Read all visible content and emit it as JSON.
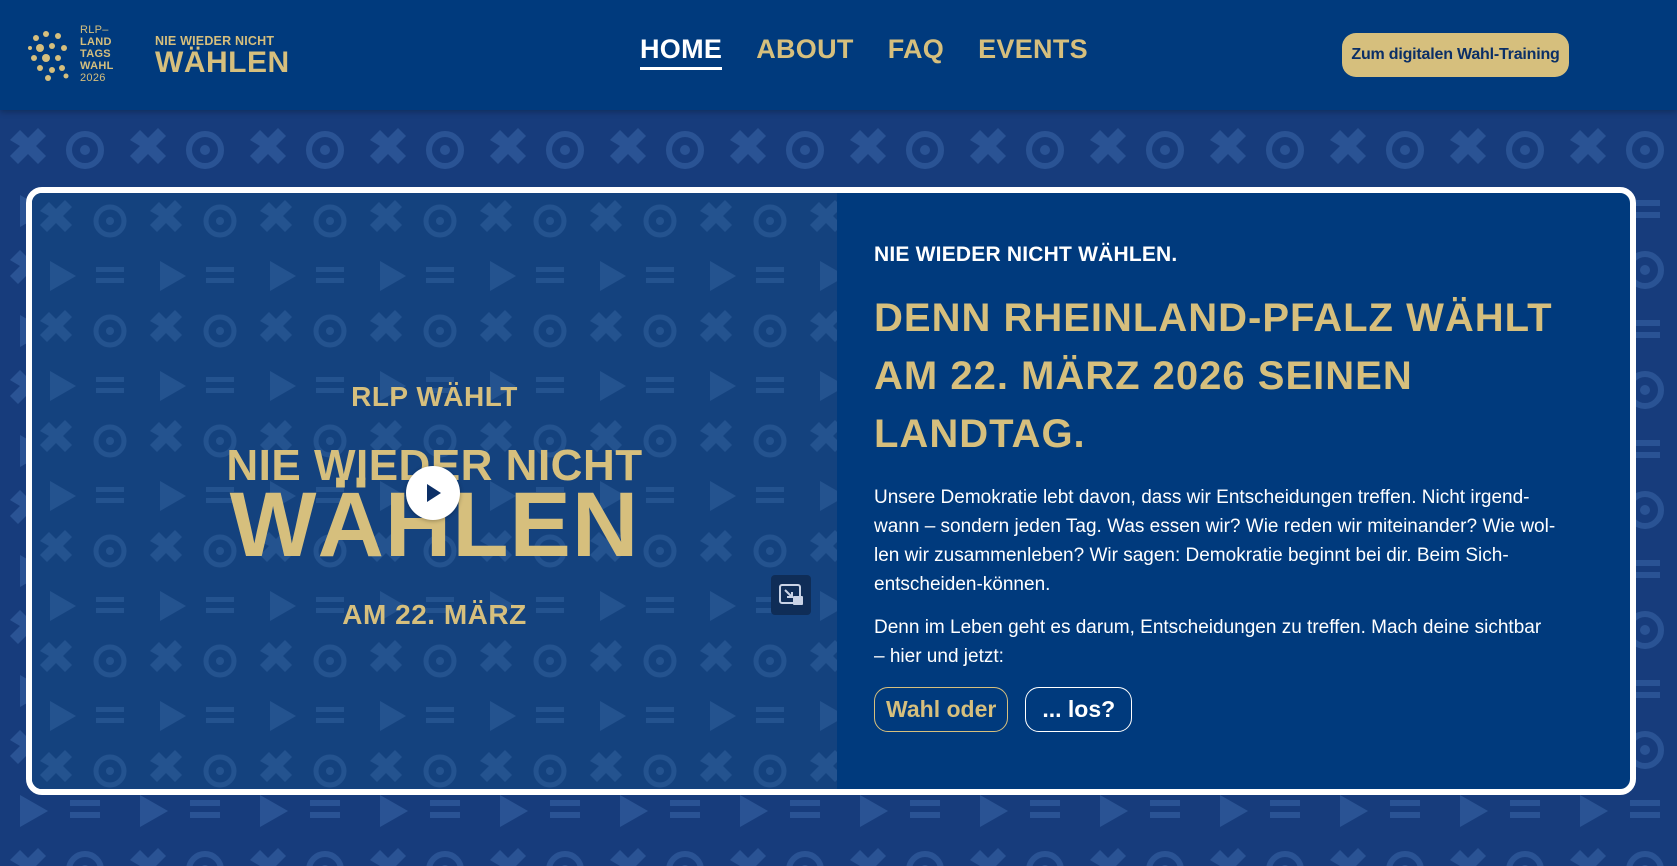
{
  "header": {
    "logo_small": [
      "RLP–",
      "LAND",
      "TAGS",
      "WAHL",
      "2026"
    ],
    "logo_main_line1": "NIE WIEDER NICHT",
    "logo_main_line2": "WÄHLEN",
    "nav": [
      {
        "label": "HOME",
        "active": true
      },
      {
        "label": "ABOUT",
        "active": false
      },
      {
        "label": "FAQ",
        "active": false
      },
      {
        "label": "EVENTS",
        "active": false
      }
    ],
    "cta_label": "Zum digitalen Wahl-Training"
  },
  "video": {
    "line1": "RLP WÄHLT",
    "line2": "NIE WIEDER NICHT",
    "line3": "WÄHLEN",
    "line4": "AM 22. MÄRZ",
    "play_icon": "play-icon",
    "pip_icon": "picture-in-picture-icon"
  },
  "content": {
    "kicker": "NIE WIEDER NICHT WÄHLEN.",
    "headline_lines": [
      "DENN RHEINLAND-PFALZ WÄHLT",
      "AM 22. MÄRZ 2026 SEINEN",
      "LANDTAG."
    ],
    "paragraph1_lines": [
      "Unsere Demokratie lebt davon, dass wir Entscheidungen treffen. Nicht irgend-",
      "wann – sondern jeden Tag. Was essen wir? Wie reden wir miteinander? Wie wol-",
      "len wir zusammenleben? Wir sagen: Demokratie beginnt bei dir. Beim Sich-",
      "entscheiden-können."
    ],
    "paragraph2_lines": [
      "Denn im Leben geht es darum, Entscheidungen zu treffen. Mach deine sichtbar",
      "– hier und jetzt:"
    ],
    "button_primary": "Wahl oder",
    "button_secondary": "... los?"
  },
  "colors": {
    "navy": "#003a7d",
    "gold": "#d6bf7d",
    "white": "#ffffff"
  }
}
